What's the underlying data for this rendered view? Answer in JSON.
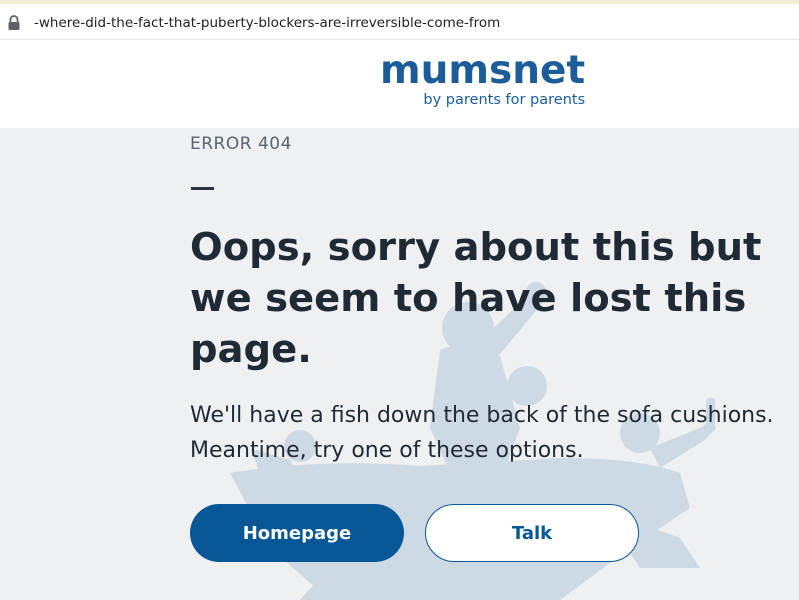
{
  "browser": {
    "url": "-where-did-the-fact-that-puberty-blockers-are-irreversible-come-from"
  },
  "header": {
    "logo_text": "mumsnet",
    "tagline": "by parents for parents"
  },
  "error": {
    "code": "ERROR 404",
    "headline": "Oops, sorry about this but we seem to have lost this page.",
    "message": "We'll have a fish down the back of the sofa cushions. Meantime, try one of these options."
  },
  "actions": {
    "homepage_label": "Homepage",
    "talk_label": "Talk"
  },
  "colors": {
    "brand": "#1c5d99",
    "button_primary": "#075696",
    "background": "#eef0f1",
    "heading": "#1f2a35"
  },
  "icons": {
    "address_bar": "lock-icon",
    "background_art": "celebrating-family-silhouette"
  }
}
